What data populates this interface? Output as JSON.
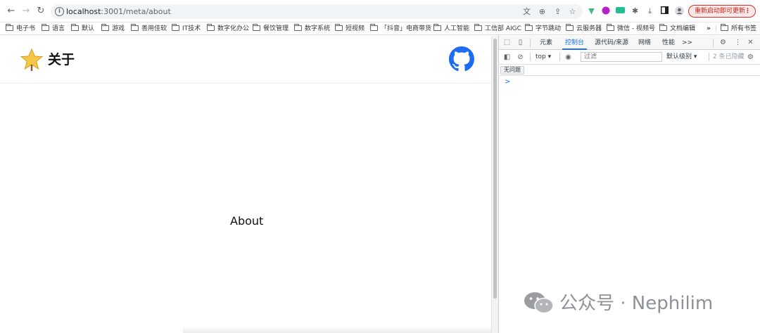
{
  "browser": {
    "url_host": "localhost",
    "url_rest": ":3001/meta/about",
    "relaunch_label": "重新启动即可更新",
    "nav_icons": [
      "back-arrow-icon",
      "forward-arrow-icon",
      "reload-icon"
    ]
  },
  "bookmarks": [
    "电子书",
    "语言",
    "默认",
    "游戏",
    "善用佳软",
    "IT技术",
    "数字化办公",
    "餐饮管理",
    "数字系统",
    "短视频",
    "「抖音」电商带货",
    "人工智能",
    "工信部 AIGC",
    "字节跳动",
    "云服务器",
    "微信 - 视频号",
    "文档编辑"
  ],
  "bookmarks_overflow": "»",
  "bookmarks_all": "所有书签",
  "page": {
    "title": "关于",
    "body_text": "About"
  },
  "devtools": {
    "tabs": [
      "元素",
      "控制台",
      "源代码/来源",
      "网络",
      "性能"
    ],
    "active_tab": "控制台",
    "more_tabs": ">>",
    "context": "top",
    "filter_placeholder": "过滤",
    "levels": "默认级别",
    "hidden_count": "2 条已隐藏",
    "issues": "无问题",
    "prompt": ">"
  },
  "watermark": {
    "text": "公众号 · Nephilim"
  },
  "colors": {
    "accent": "#1a73e8",
    "github": "#1e6cf3",
    "relaunch": "#c5221f"
  }
}
